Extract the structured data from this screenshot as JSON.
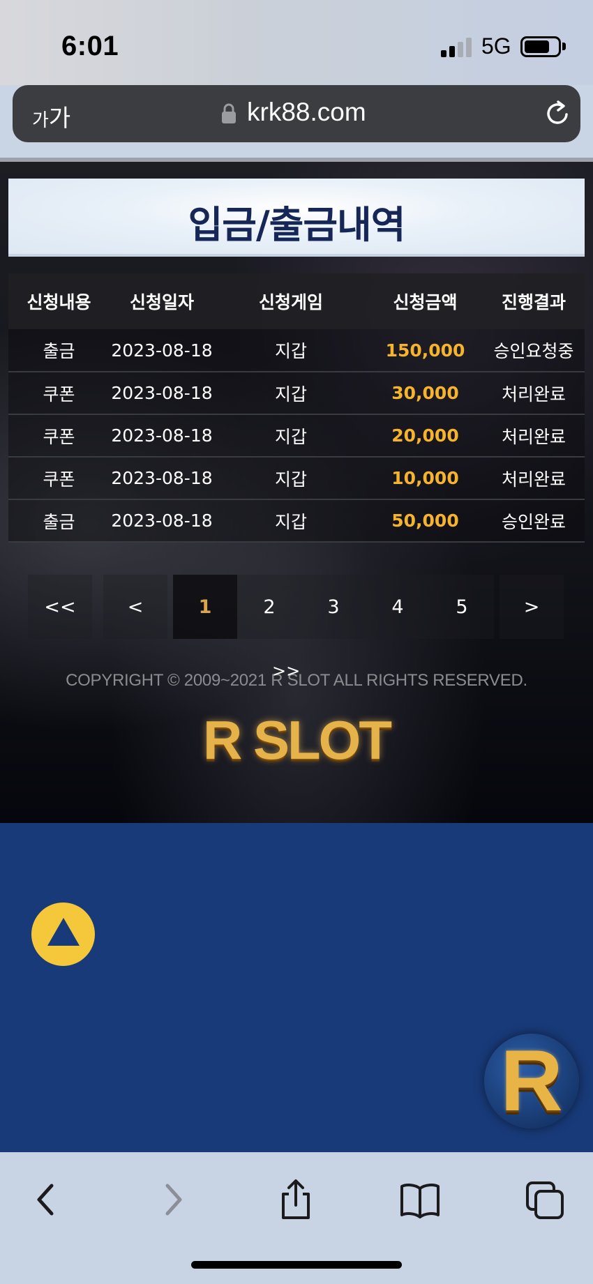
{
  "status_bar": {
    "time": "6:01",
    "network": "5G",
    "battery_level": 0.75
  },
  "browser": {
    "reader_label_small": "가",
    "reader_label_large": "가",
    "url": "krk88.com"
  },
  "page": {
    "title": "입금/출금내역",
    "table": {
      "headers": [
        "신청내용",
        "신청일자",
        "신청게임",
        "신청금액",
        "진행결과"
      ],
      "rows": [
        {
          "type": "출금",
          "date": "2023-08-18",
          "game": "지갑",
          "amount": "150,000",
          "status": "승인요청중"
        },
        {
          "type": "쿠폰",
          "date": "2023-08-18",
          "game": "지갑",
          "amount": "30,000",
          "status": "처리완료"
        },
        {
          "type": "쿠폰",
          "date": "2023-08-18",
          "game": "지갑",
          "amount": "20,000",
          "status": "처리완료"
        },
        {
          "type": "쿠폰",
          "date": "2023-08-18",
          "game": "지갑",
          "amount": "10,000",
          "status": "처리완료"
        },
        {
          "type": "출금",
          "date": "2023-08-18",
          "game": "지갑",
          "amount": "50,000",
          "status": "승인완료"
        }
      ]
    },
    "pagination": {
      "first": "<<",
      "prev": "<",
      "pages": [
        "1",
        "2",
        "3",
        "4",
        "5"
      ],
      "current": "1",
      "next": ">",
      "last": ">>"
    },
    "copyright": "COPYRIGHT © 2009~2021 R SLOT ALL RIGHTS RESERVED.",
    "footer_logo": "R SLOT",
    "chat_badge_letter": "R"
  },
  "colors": {
    "title_text": "#162656",
    "amount_text": "#f6b42c",
    "active_page": "#d9a64a",
    "blue_area": "#183a78",
    "scroll_button": "#f4c83a",
    "ios_blue": "#1a73e8"
  },
  "icons": {
    "scroll_top": "triangle-up-icon",
    "back": "chevron-left-icon",
    "forward": "chevron-right-icon",
    "share": "share-icon",
    "bookmarks": "book-icon",
    "tabs": "tabs-icon"
  }
}
